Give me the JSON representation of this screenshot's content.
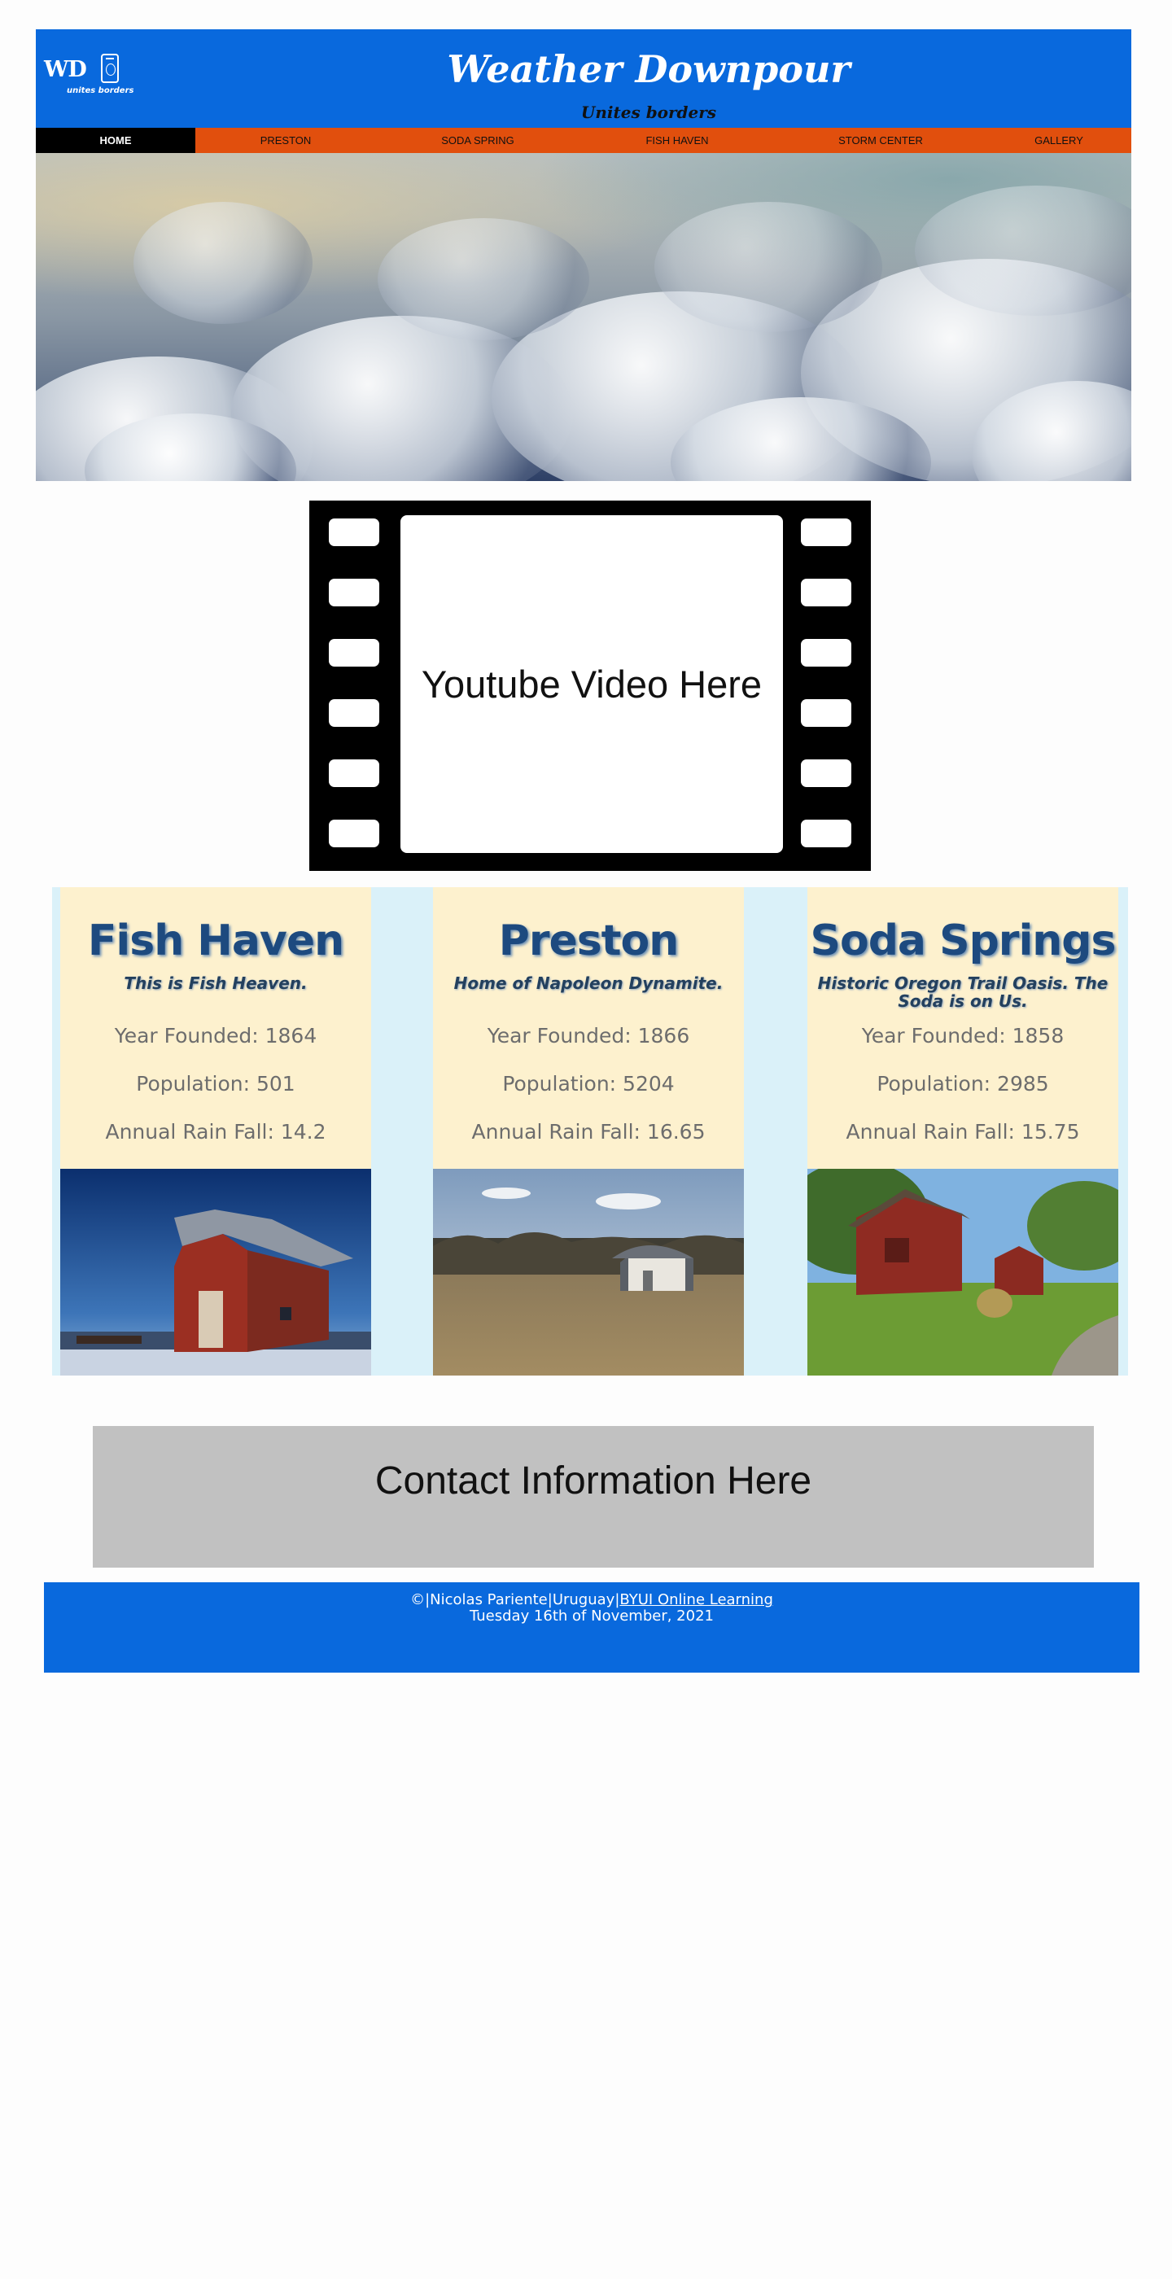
{
  "header": {
    "logo_text": "WD",
    "logo_tagline": "unites borders",
    "title": "Weather Downpour",
    "tagline": "Unites borders"
  },
  "nav": {
    "items": [
      {
        "label": "HOME",
        "active": true
      },
      {
        "label": "PRESTON"
      },
      {
        "label": "SODA SPRING"
      },
      {
        "label": "FISH HAVEN"
      },
      {
        "label": "STORM CENTER"
      },
      {
        "label": "GALLERY"
      }
    ]
  },
  "video": {
    "placeholder": "Youtube Video Here"
  },
  "towns": [
    {
      "name": "Fish Haven",
      "motto": "This is Fish Heaven.",
      "year_founded": "Year Founded: 1864",
      "population": "Population: 501",
      "rainfall": "Annual Rain Fall: 14.2"
    },
    {
      "name": "Preston",
      "motto": "Home of Napoleon Dynamite.",
      "year_founded": "Year Founded: 1866",
      "population": "Population: 5204",
      "rainfall": "Annual Rain Fall: 16.65"
    },
    {
      "name": "Soda Springs",
      "motto": "Historic Oregon Trail Oasis. The Soda is on Us.",
      "year_founded": "Year Founded: 1858",
      "population": "Population: 2985",
      "rainfall": "Annual Rain Fall: 15.75"
    }
  ],
  "contact": {
    "placeholder": "Contact Information Here"
  },
  "footer": {
    "credits": "©|Nicolas Pariente|Uruguay|",
    "link": "BYUI Online Learning",
    "date": "Tuesday 16th of November, 2021"
  },
  "colors": {
    "header_blue": "#0969dd",
    "nav_orange": "#e14f0d",
    "nav_active": "#000000",
    "town_card": "#fdf1ce",
    "towns_bg": "#daf1f9",
    "contact_gray": "#c1c1c1"
  }
}
